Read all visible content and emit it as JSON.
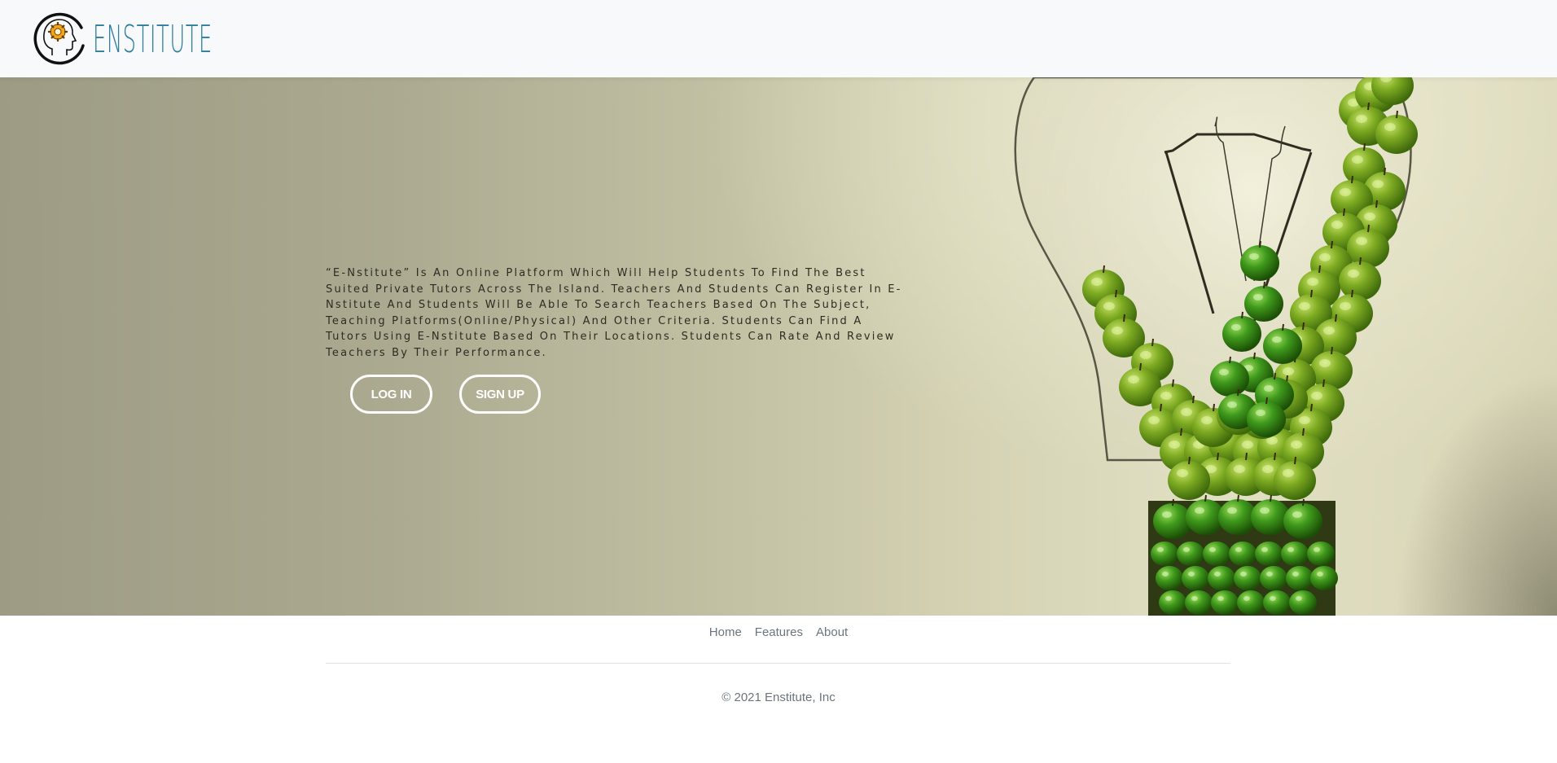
{
  "header": {
    "brand_name": "ENSTITUTE",
    "logo_icon": "head-brain-gear-icon"
  },
  "hero": {
    "description": "“E-Nstitute” Is An Online Platform Which Will Help Students To Find The Best Suited Private Tutors Across The Island. Teachers And Students Can Register In E-Nstitute And Students Will Be Able To Search Teachers Based On The Subject, Teaching Platforms(Online/Physical) And Other Criteria. Students Can Find A Tutors Using E-Nstitute Based On Their Locations. Students Can Rate And Review Teachers By Their Performance.",
    "login_label": "LOG IN",
    "signup_label": "SIGN UP",
    "background_image": "lightbulb-made-of-green-apples"
  },
  "footer": {
    "nav": [
      {
        "label": "Home"
      },
      {
        "label": "Features"
      },
      {
        "label": "About"
      }
    ],
    "copyright": "© 2021 Enstitute, Inc"
  },
  "colors": {
    "brand": "#2e7d9e",
    "header_bg": "#f7f9fb",
    "footer_text": "#6c757d",
    "apple_green": "#6a9a1e"
  }
}
